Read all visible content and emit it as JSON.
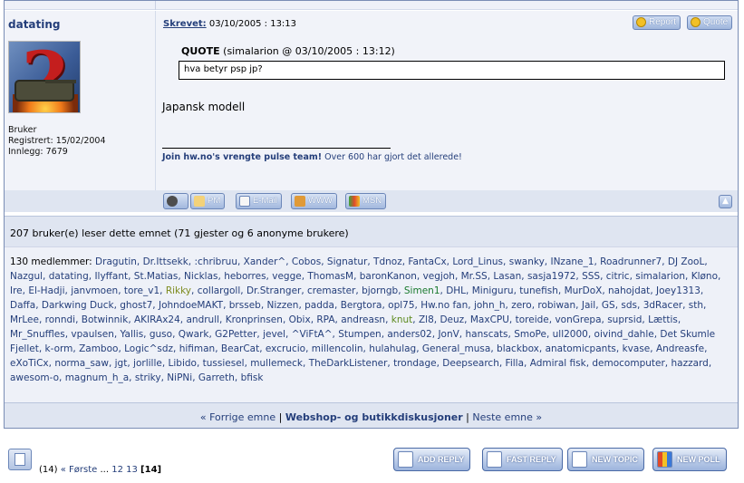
{
  "post": {
    "username": "datating",
    "user_title": "Bruker",
    "registered": "Registrert: 15/02/2004",
    "posts": "Innlegg: 7679",
    "written_label": "Skrevet:",
    "timestamp": "03/10/2005 : 13:13",
    "report_label": "Report",
    "quote_label": "Quote",
    "quote_title": "QUOTE",
    "quote_source": "(simalarion @ 03/10/2005 : 13:12)",
    "quote_text": "hva betyr psp jp?",
    "body": "Japansk modell",
    "signature_bold": "Join hw.no's vrengte pulse team!",
    "signature_rest": "Over 600 har gjort det allerede!",
    "buttons": {
      "pm": "PM",
      "email": "E-Mail",
      "www": "WWW",
      "msn": "MSN"
    }
  },
  "readers": {
    "summary": "207 bruker(e) leser dette emnet (71 gjester og 6 anonyme brukere)",
    "members_lead": "130 medlemmer:",
    "members": [
      "Dragutin",
      "Dr.Ittsekk",
      ":chribruu",
      "Xander^",
      "Cobos",
      "Signatur",
      "Tdnoz",
      "FantaCx",
      "Lord_Linus",
      "swanky",
      "INzane_1",
      "Roadrunner7",
      "DJ ZooL",
      "Nazgul",
      "datating",
      "Ilyffant",
      "St.Matias",
      "Nicklas",
      "heborres",
      "vegge",
      "ThomasM",
      "baronKanon",
      "vegjoh",
      "Mr.SS",
      "Lasan",
      "sasja1972",
      "SSS",
      "citric",
      "simalarion",
      "Kløno",
      "Ire",
      "El-Hadji",
      "janvmoen",
      "tore_v1",
      "Rikky",
      "collargoll",
      "Dr.Stranger",
      "cremaster",
      "bjorngb",
      "Simen1",
      "DHL",
      "Miniguru",
      "tunefish",
      "MurDoX",
      "nahojdat",
      "Joey1313",
      "Daffa",
      "Darkwing Duck",
      "ghost7",
      "JohndoeMAKT",
      "brsseb",
      "Nizzen",
      "padda",
      "Bergtora",
      "opl75",
      "Hw.no fan",
      "john_h",
      "zero",
      "robiwan",
      "Jail",
      "GS",
      "sds",
      "3dRacer",
      "sth",
      "MrLee",
      "ronndi",
      "Botwinnik",
      "AKIRAx24",
      "andrull",
      "Kronprinsen",
      "Obix",
      "RPA",
      "andreasn",
      "knut",
      "Zl8",
      "Deuz",
      "MaxCPU",
      "toreide",
      "vonGrepa",
      "suprsid",
      "Lættis",
      "Mr_Snuffles",
      "vpaulsen",
      "Yallis",
      "guso",
      "Qwark",
      "G2Petter",
      "jevel",
      "^ViFtA^",
      "Stumpen",
      "anders02",
      "JonV",
      "hanscats",
      "SmoPe",
      "ull2000",
      "oivind_dahle",
      "Det Skumle Fjellet",
      "k-orm",
      "Zamboo",
      "Logic^sdz",
      "hifiman",
      "BearCat",
      "excrucio",
      "millencolin",
      "hulahulag",
      "General_musa",
      "blackbox",
      "anatomicpants",
      "kvase",
      "Andreasfe",
      "eXoTiCx",
      "norma_saw",
      "jgt",
      "jorlille",
      "Libido",
      "tussiesel",
      "mullemeck",
      "TheDarkListener",
      "trondage",
      "Deepsearch",
      "Filla",
      "Admiral fisk",
      "democomputer",
      "hazzard",
      "awesom-o",
      "magnum_h_a",
      "striky",
      "NiPNi",
      "Garreth",
      "bfisk"
    ]
  },
  "nav": {
    "prev": "« Forrige emne",
    "forum": "Webshop- og butikkdiskusjoner",
    "next": "Neste emne »"
  },
  "pager": {
    "count": "(14)",
    "first": "« Første",
    "ellipsis": "...",
    "p12": "12",
    "p13": "13",
    "current": "[14]"
  },
  "actions": {
    "add_reply": "ADD REPLY",
    "fast_reply": "FAST REPLY",
    "new_topic": "NEW TOPIC",
    "new_poll": "NEW POLL"
  }
}
